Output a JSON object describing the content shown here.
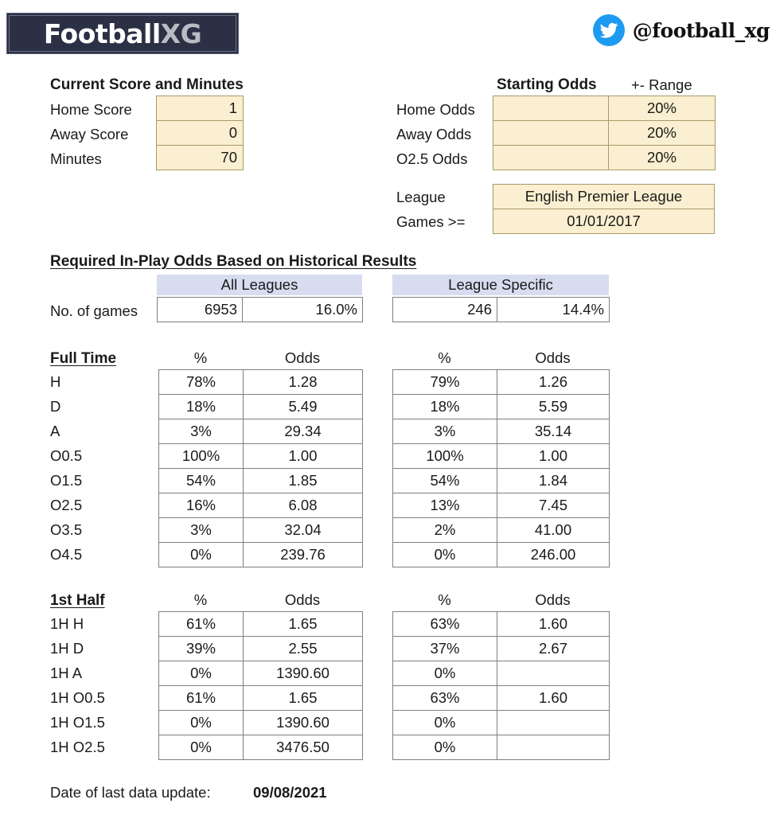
{
  "logo": {
    "word1": "Football",
    "word2": "XG"
  },
  "social": {
    "icon": "twitter-icon",
    "handle": "@football_xg"
  },
  "inputs": {
    "left_title": "Current Score and Minutes",
    "rows": [
      {
        "label": "Home Score",
        "value": "1"
      },
      {
        "label": "Away Score",
        "value": "0"
      },
      {
        "label": "Minutes",
        "value": "70"
      }
    ],
    "right_title": "Starting Odds",
    "right_subtitle": "+- Range",
    "odds_rows": [
      {
        "label": "Home Odds",
        "odds": "",
        "range": "20%"
      },
      {
        "label": "Away Odds",
        "odds": "",
        "range": "20%"
      },
      {
        "label": "O2.5 Odds",
        "odds": "",
        "range": "20%"
      }
    ],
    "league_label": "League",
    "league_value": "English Premier League",
    "games_label": "Games >=",
    "games_value": "01/01/2017"
  },
  "section": {
    "title": "Required In-Play Odds Based on Historical Results",
    "band_left": "All Leagues",
    "band_right": "League Specific",
    "games_label": "No. of games",
    "all_leagues_games": "6953",
    "all_leagues_pct": "16.0%",
    "league_specific_games": "246",
    "league_specific_pct": "14.4%"
  },
  "full_time": {
    "title": "Full Time",
    "col_pct": "%",
    "col_odds": "Odds",
    "labels": [
      "H",
      "D",
      "A",
      "O0.5",
      "O1.5",
      "O2.5",
      "O3.5",
      "O4.5"
    ],
    "all_leagues": [
      {
        "pct": "78%",
        "odds": "1.28"
      },
      {
        "pct": "18%",
        "odds": "5.49"
      },
      {
        "pct": "3%",
        "odds": "29.34"
      },
      {
        "pct": "100%",
        "odds": "1.00"
      },
      {
        "pct": "54%",
        "odds": "1.85"
      },
      {
        "pct": "16%",
        "odds": "6.08"
      },
      {
        "pct": "3%",
        "odds": "32.04"
      },
      {
        "pct": "0%",
        "odds": "239.76"
      }
    ],
    "league_specific": [
      {
        "pct": "79%",
        "odds": "1.26"
      },
      {
        "pct": "18%",
        "odds": "5.59"
      },
      {
        "pct": "3%",
        "odds": "35.14"
      },
      {
        "pct": "100%",
        "odds": "1.00"
      },
      {
        "pct": "54%",
        "odds": "1.84"
      },
      {
        "pct": "13%",
        "odds": "7.45"
      },
      {
        "pct": "2%",
        "odds": "41.00"
      },
      {
        "pct": "0%",
        "odds": "246.00"
      }
    ]
  },
  "first_half": {
    "title": "1st Half",
    "col_pct": "%",
    "col_odds": "Odds",
    "labels": [
      "1H H",
      "1H D",
      "1H A",
      "1H O0.5",
      "1H O1.5",
      "1H O2.5"
    ],
    "all_leagues": [
      {
        "pct": "61%",
        "odds": "1.65"
      },
      {
        "pct": "39%",
        "odds": "2.55"
      },
      {
        "pct": "0%",
        "odds": "1390.60"
      },
      {
        "pct": "61%",
        "odds": "1.65"
      },
      {
        "pct": "0%",
        "odds": "1390.60"
      },
      {
        "pct": "0%",
        "odds": "3476.50"
      }
    ],
    "league_specific": [
      {
        "pct": "63%",
        "odds": "1.60"
      },
      {
        "pct": "37%",
        "odds": "2.67"
      },
      {
        "pct": "0%",
        "odds": ""
      },
      {
        "pct": "63%",
        "odds": "1.60"
      },
      {
        "pct": "0%",
        "odds": ""
      },
      {
        "pct": "0%",
        "odds": ""
      }
    ]
  },
  "footer": {
    "label": "Date of last data update:",
    "value": "09/08/2021"
  },
  "colors": {
    "input_fill": "#faefd0",
    "input_border": "#a89a69",
    "band_fill": "#d7dcf0",
    "grid_border": "#7f7f7f",
    "logo_bg": "#2b3044",
    "twitter_blue": "#1d9bf0"
  }
}
